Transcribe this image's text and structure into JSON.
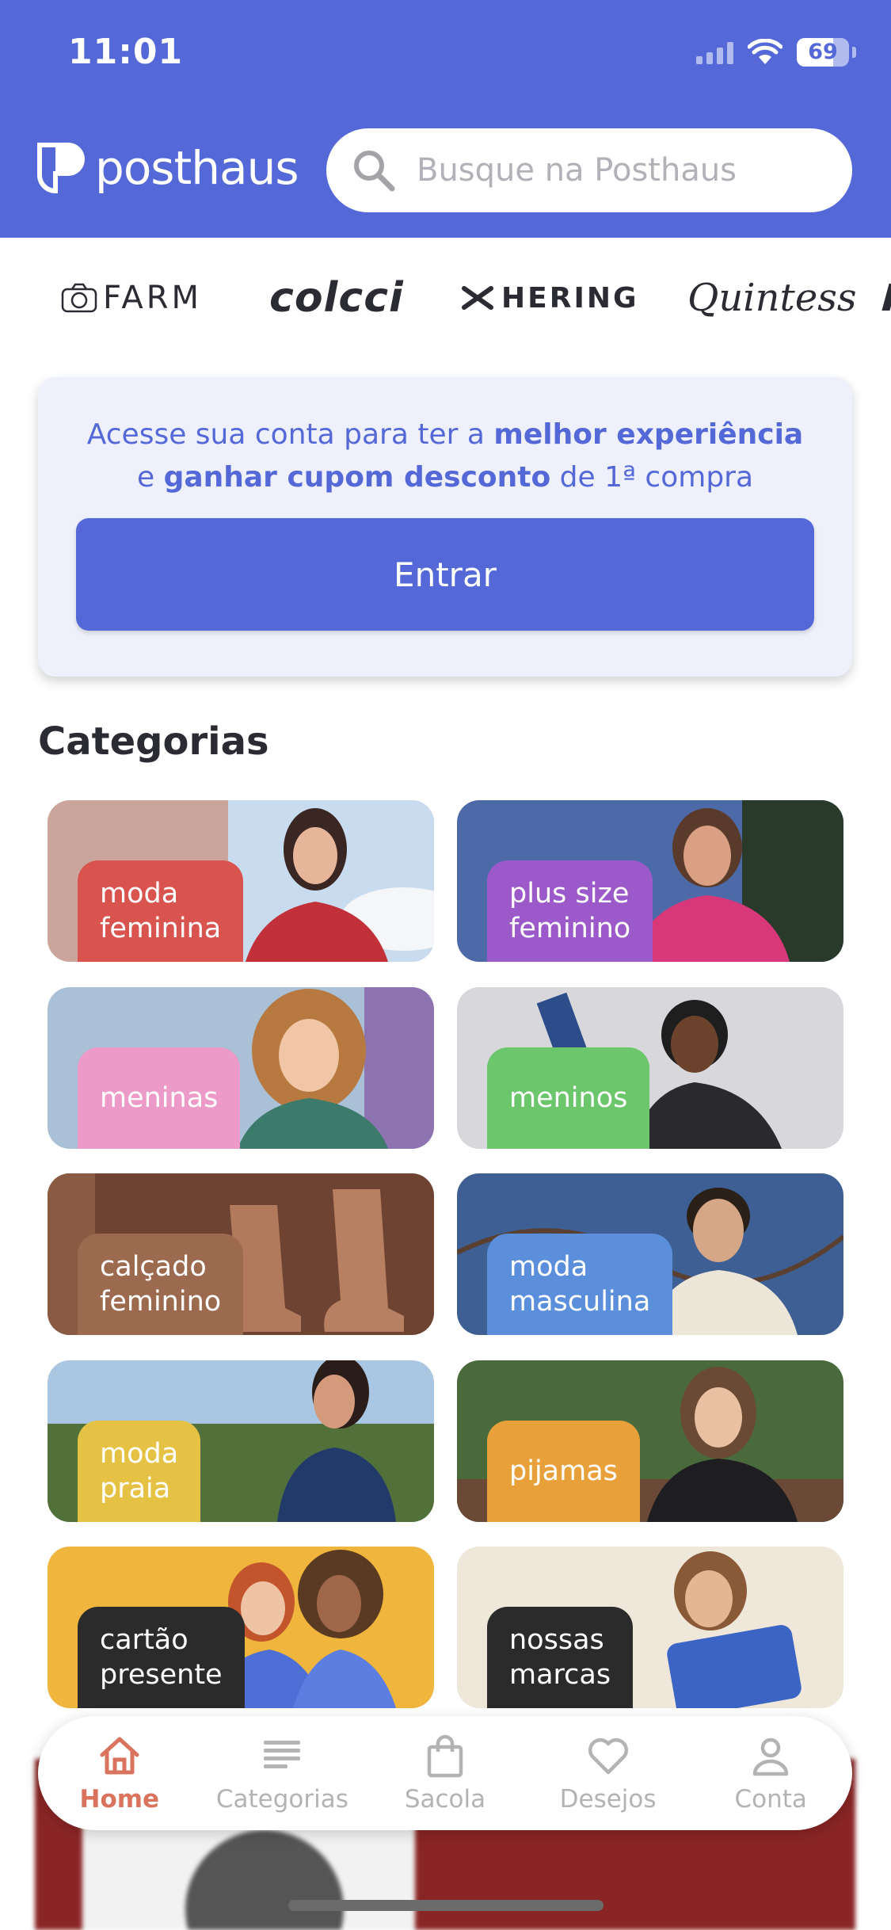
{
  "status_bar": {
    "time": "11:01",
    "battery": "69",
    "battery_level": 0.69
  },
  "header": {
    "logo_text": "posthaus",
    "search_placeholder": "Busque na Posthaus"
  },
  "brands": [
    "FARM",
    "colcci",
    "HERING",
    "Quintess"
  ],
  "login_card": {
    "line1_prefix": "Acesse sua conta para ter a ",
    "line1_bold": "melhor experiência",
    "line2_prefix": "e ",
    "line2_bold": "ganhar cupom desconto",
    "line2_suffix": " de 1ª compra",
    "button": "Entrar"
  },
  "categories": {
    "title": "Categorias",
    "items": [
      {
        "line1": "moda",
        "line2": "feminina",
        "label_color": "#d9534f",
        "bg": "#c9a59c"
      },
      {
        "line1": "plus size",
        "line2": "feminino",
        "label_color": "#9b59c9",
        "bg": "#4d6aa8"
      },
      {
        "line1": "meninas",
        "line2": "",
        "label_color": "#ec9ac7",
        "bg": "#a9c0d6"
      },
      {
        "line1": "meninos",
        "line2": "",
        "label_color": "#6cc66c",
        "bg": "#d8d8dc"
      },
      {
        "line1": "calçado",
        "line2": "feminino",
        "label_color": "#9c6a4e",
        "bg": "#6e4332"
      },
      {
        "line1": "moda",
        "line2": "masculina",
        "label_color": "#5b8fdc",
        "bg": "#3e5f94"
      },
      {
        "line1": "moda",
        "line2": "praia",
        "label_color": "#e6c244",
        "bg": "#7ea25a"
      },
      {
        "line1": "pijamas",
        "line2": "",
        "label_color": "#e8a13a",
        "bg": "#4a6a3c"
      },
      {
        "line1": "cartão",
        "line2": "presente",
        "label_color": "#2b2b2b",
        "bg": "#f0b53c"
      },
      {
        "line1": "nossas",
        "line2": "marcas",
        "label_color": "#2b2b2b",
        "bg": "#efe8da"
      }
    ]
  },
  "bottom_nav": {
    "items": [
      {
        "label": "Home",
        "icon": "home-icon",
        "active": true
      },
      {
        "label": "Categorias",
        "icon": "list-icon",
        "active": false
      },
      {
        "label": "Sacola",
        "icon": "bag-icon",
        "active": false
      },
      {
        "label": "Desejos",
        "icon": "heart-icon",
        "active": false
      },
      {
        "label": "Conta",
        "icon": "user-icon",
        "active": false
      }
    ]
  },
  "colors": {
    "brand": "#5468d8",
    "nav_active": "#d9735d",
    "nav_inactive": "#b3b3b3"
  }
}
